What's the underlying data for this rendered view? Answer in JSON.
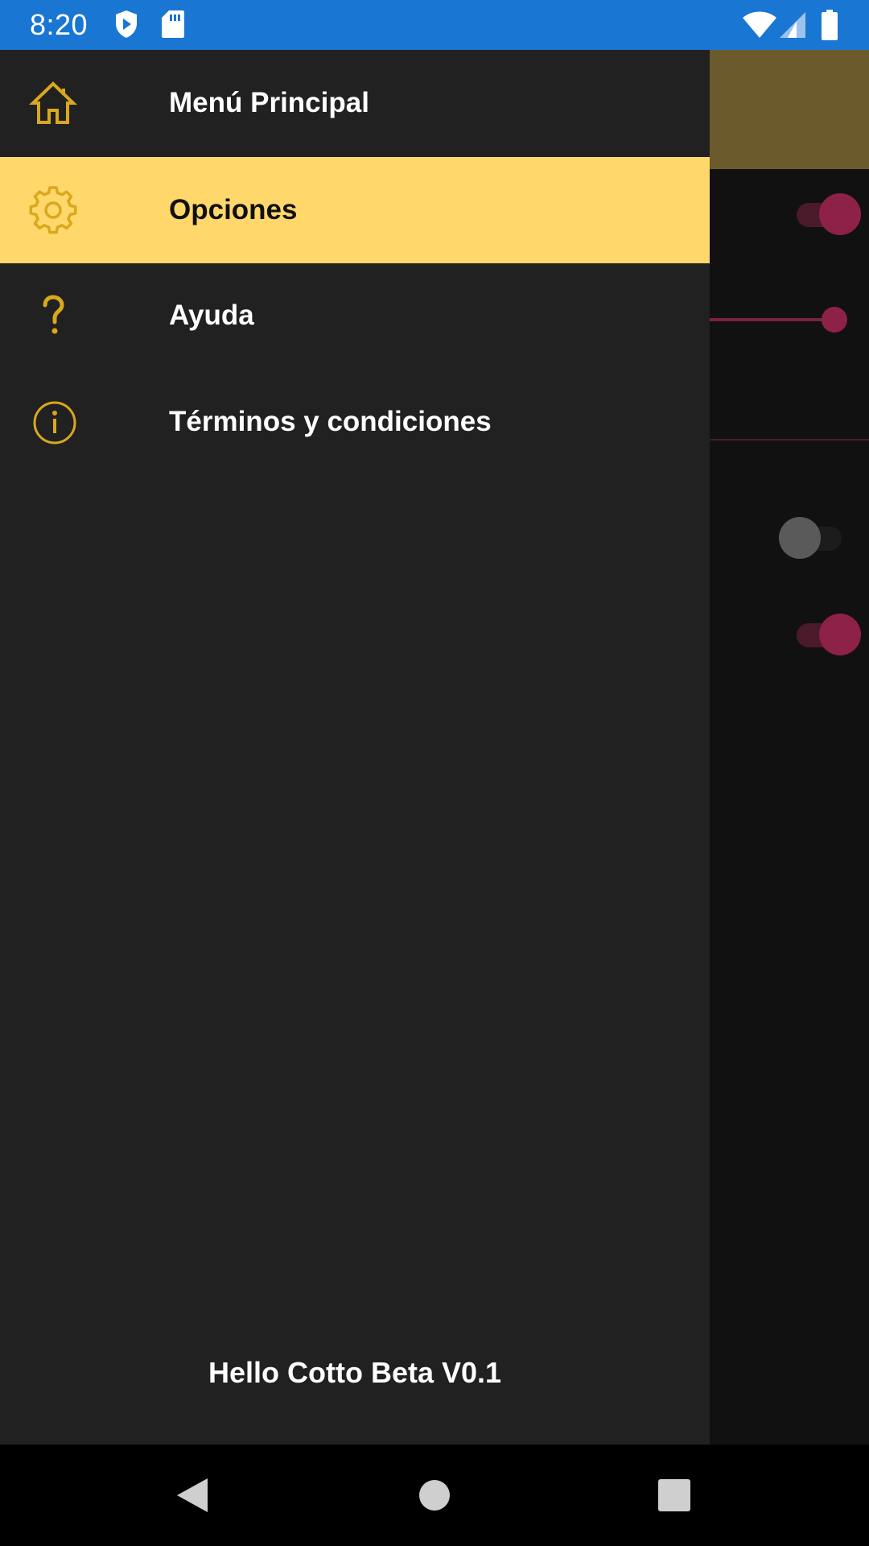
{
  "status_bar": {
    "time": "8:20",
    "left_icons": [
      "play-protect-icon",
      "sd-card-icon"
    ],
    "right_icons": [
      "wifi-icon",
      "cell-signal-icon",
      "battery-icon"
    ],
    "background_color": "#1976d2"
  },
  "background_app": {
    "toolbar_color": "#6b5a2c",
    "switches": [
      {
        "name": "switch-1",
        "on": true
      },
      {
        "name": "switch-2",
        "on": false
      },
      {
        "name": "switch-3",
        "on": true
      }
    ],
    "slider_value": 1.0,
    "accent_color": "#8e2147"
  },
  "drawer": {
    "background_color": "#212121",
    "selected_color": "#ffd76a",
    "icon_color": "#d9a81c",
    "items": [
      {
        "label": "Menú Principal",
        "icon": "home-icon",
        "selected": false
      },
      {
        "label": "Opciones",
        "icon": "gear-icon",
        "selected": true
      },
      {
        "label": "Ayuda",
        "icon": "question-icon",
        "selected": false
      },
      {
        "label": "Términos y condiciones",
        "icon": "info-icon",
        "selected": false
      }
    ],
    "footer": "Hello Cotto Beta V0.1"
  },
  "nav_bar": {
    "buttons": [
      "back-icon",
      "home-circle-icon",
      "recents-icon"
    ]
  }
}
